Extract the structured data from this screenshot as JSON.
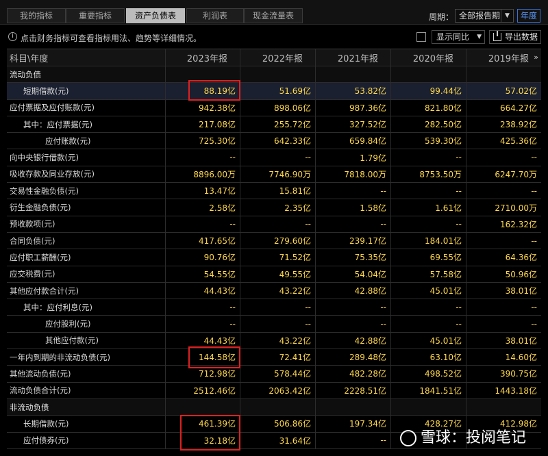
{
  "tabs": [
    {
      "label": "我的指标",
      "active": false
    },
    {
      "label": "重要指标",
      "active": false
    },
    {
      "label": "资产负债表",
      "active": true
    },
    {
      "label": "利润表",
      "active": false
    },
    {
      "label": "现金流量表",
      "active": false
    }
  ],
  "period": {
    "label": "周期：",
    "selected": "全部报告期",
    "year_button": "年度"
  },
  "infobar": {
    "text": "点击财务指标可查看指标用法、趋势等详细情况。",
    "compare_selected": "显示同比",
    "export_label": "导出数据"
  },
  "table": {
    "header": [
      "科目\\年度",
      "2023年报",
      "2022年报",
      "2021年报",
      "2020年报",
      "2019年报"
    ],
    "rows": [
      {
        "type": "section",
        "label": "流动负债",
        "values": [
          "",
          "",
          "",
          "",
          ""
        ]
      },
      {
        "type": "row",
        "indent": 1,
        "label": "短期借款(元)",
        "values": [
          "88.19亿",
          "51.69亿",
          "53.82亿",
          "99.44亿",
          "57.02亿"
        ],
        "highlight": true
      },
      {
        "type": "row",
        "indent": 0,
        "label": "应付票据及应付账款(元)",
        "values": [
          "942.38亿",
          "898.06亿",
          "987.36亿",
          "821.80亿",
          "664.27亿"
        ]
      },
      {
        "type": "row",
        "indent": 1,
        "label": "其中：应付票据(元)",
        "values": [
          "217.08亿",
          "255.72亿",
          "327.52亿",
          "282.50亿",
          "238.92亿"
        ]
      },
      {
        "type": "row",
        "indent": 2,
        "label": "应付账款(元)",
        "values": [
          "725.30亿",
          "642.33亿",
          "659.84亿",
          "539.30亿",
          "425.36亿"
        ]
      },
      {
        "type": "row",
        "indent": 0,
        "label": "向中央银行借款(元)",
        "values": [
          "--",
          "--",
          "1.79亿",
          "--",
          "--"
        ]
      },
      {
        "type": "row",
        "indent": 0,
        "label": "吸收存款及同业存放(元)",
        "values": [
          "8896.00万",
          "7746.90万",
          "7818.00万",
          "8753.50万",
          "6247.70万"
        ]
      },
      {
        "type": "row",
        "indent": 0,
        "label": "交易性金融负债(元)",
        "values": [
          "13.47亿",
          "15.81亿",
          "--",
          "--",
          "--"
        ]
      },
      {
        "type": "row",
        "indent": 0,
        "label": "衍生金融负债(元)",
        "values": [
          "2.58亿",
          "2.35亿",
          "1.58亿",
          "1.61亿",
          "2710.00万"
        ]
      },
      {
        "type": "row",
        "indent": 0,
        "label": "预收款项(元)",
        "values": [
          "--",
          "--",
          "--",
          "--",
          "162.32亿"
        ]
      },
      {
        "type": "row",
        "indent": 0,
        "label": "合同负债(元)",
        "values": [
          "417.65亿",
          "279.60亿",
          "239.17亿",
          "184.01亿",
          "--"
        ]
      },
      {
        "type": "row",
        "indent": 0,
        "label": "应付职工薪酬(元)",
        "values": [
          "90.76亿",
          "71.52亿",
          "75.35亿",
          "69.55亿",
          "64.36亿"
        ]
      },
      {
        "type": "row",
        "indent": 0,
        "label": "应交税费(元)",
        "values": [
          "54.55亿",
          "49.55亿",
          "54.04亿",
          "57.58亿",
          "50.96亿"
        ]
      },
      {
        "type": "row",
        "indent": 0,
        "label": "其他应付款合计(元)",
        "values": [
          "44.43亿",
          "43.22亿",
          "42.88亿",
          "45.01亿",
          "38.01亿"
        ]
      },
      {
        "type": "row",
        "indent": 1,
        "label": "其中：应付利息(元)",
        "values": [
          "--",
          "--",
          "--",
          "--",
          "--"
        ]
      },
      {
        "type": "row",
        "indent": 2,
        "label": "应付股利(元)",
        "values": [
          "--",
          "--",
          "--",
          "--",
          "--"
        ]
      },
      {
        "type": "row",
        "indent": 2,
        "label": "其他应付款(元)",
        "values": [
          "44.43亿",
          "43.22亿",
          "42.88亿",
          "45.01亿",
          "38.01亿"
        ]
      },
      {
        "type": "row",
        "indent": 0,
        "label": "一年内到期的非流动负债(元)",
        "values": [
          "144.58亿",
          "72.41亿",
          "289.48亿",
          "63.10亿",
          "14.60亿"
        ]
      },
      {
        "type": "row",
        "indent": 0,
        "label": "其他流动负债(元)",
        "values": [
          "712.98亿",
          "578.44亿",
          "482.28亿",
          "498.52亿",
          "390.75亿"
        ]
      },
      {
        "type": "row",
        "indent": 0,
        "label": "流动负债合计(元)",
        "values": [
          "2512.46亿",
          "2063.42亿",
          "2228.51亿",
          "1841.51亿",
          "1443.18亿"
        ]
      },
      {
        "type": "section",
        "label": "非流动负债",
        "values": [
          "",
          "",
          "",
          "",
          ""
        ]
      },
      {
        "type": "row",
        "indent": 1,
        "label": "长期借款(元)",
        "values": [
          "461.39亿",
          "506.86亿",
          "197.34亿",
          "428.27亿",
          "412.98亿"
        ]
      },
      {
        "type": "row",
        "indent": 1,
        "label": "应付债券(元)",
        "values": [
          "32.18亿",
          "31.64亿",
          "--",
          "",
          ""
        ]
      }
    ]
  },
  "watermark": "雪球：投阅笔记"
}
